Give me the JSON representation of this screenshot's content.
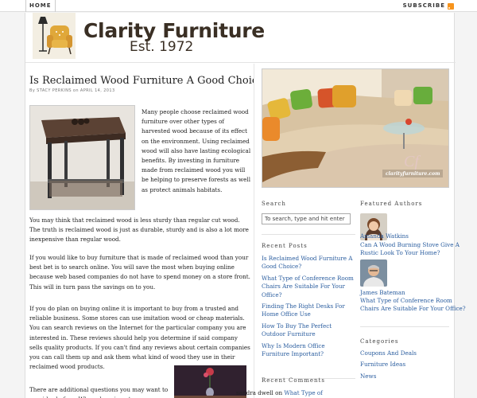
{
  "topbar": {
    "home_label": "HOME",
    "subscribe_label": "SUBSCRIBE"
  },
  "header": {
    "site_name": "Clarity Furniture",
    "tagline": "Est. 1972"
  },
  "post": {
    "title": "Is Reclaimed Wood Furniture A Good Choice?",
    "meta": "By STACY PERKINS on APRIL 14, 2013",
    "intro": "Many people choose reclaimed wood furniture over other types of harvested wood because of its effect on the environment. Using reclaimed wood will also have lasting ecological benefits. By investing in furniture made from reclaimed wood you will be helping to preserve forests as well as protect animals habitats.",
    "p1": "You may think that reclaimed wood is less sturdy than regular cut wood. The truth is reclaimed wood is just as durable, sturdy and is also a lot more inexpensive than regular wood.",
    "p2": "If you would like to buy furniture that is made of reclaimed wood than your best bet is to search online. You will save the most when buying online because web based companies do not have to spend money on a store front. This will in turn pass the savings on to you.",
    "p3": "If you do plan on buying online it is important to buy from a trusted and reliable business. Some stores can use imitation wood or cheap materials. You can search reviews on the Internet for the particular company you are interested in. These reviews should help you determine if said company sells quality products. If you can't find any reviews about certain companies you can call them up and ask them what kind of wood they use in their reclaimed wood products.",
    "p4": "There are additional questions you may want to consider before. When shopping at"
  },
  "feature_image": {
    "watermark": "clarityfurniture.com"
  },
  "search": {
    "title": "Search",
    "placeholder": "To search, type and hit enter"
  },
  "recent_posts": {
    "title": "Recent Posts",
    "items": [
      "Is Reclaimed Wood Furniture A Good Choice?",
      "What Type of Conference Room Chairs Are Suitable For Your Office?",
      "Finding The Right Desks For Home Office Use",
      "How To Buy The Perfect Outdoor Furniture",
      "Why Is Modern Office Furniture Important?"
    ]
  },
  "recent_comments": {
    "title": "Recent Comments",
    "author": "sandra dwell",
    "on": "on",
    "link": "What Type of"
  },
  "featured_authors": {
    "title": "Featured Authors",
    "authors": [
      {
        "name": "Amanda Watkins",
        "post": "Can A Wood Burning Stove Give A Rustic Look To Your Home?"
      },
      {
        "name": "James Bateman",
        "post": "What Type of Conference Room Chairs Are Suitable For Your Office?"
      }
    ]
  },
  "categories": {
    "title": "Categories",
    "items": [
      "Coupons And Deals",
      "Furniture Ideas",
      "News"
    ]
  }
}
